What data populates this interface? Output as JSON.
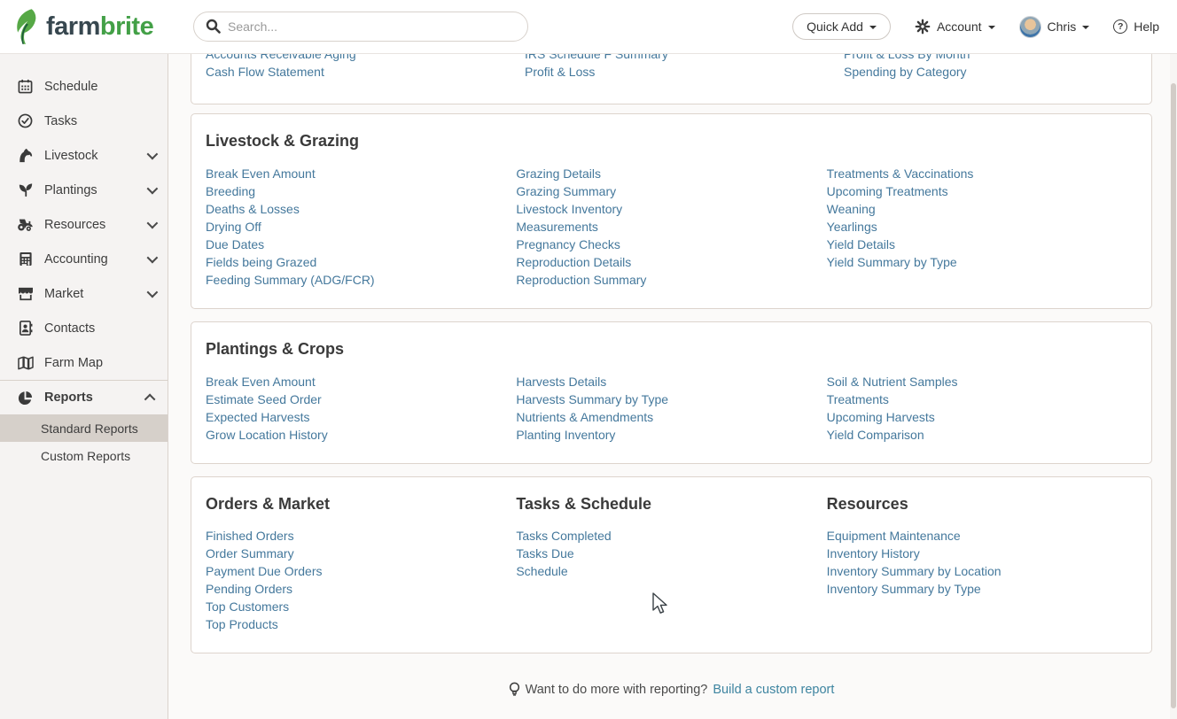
{
  "header": {
    "logo_farm": "farm",
    "logo_brite": "brite",
    "search_placeholder": "Search...",
    "quick_add_label": "Quick Add",
    "account_label": "Account",
    "user_name": "Chris",
    "help_label": "Help"
  },
  "sidebar": {
    "items": [
      {
        "label": "Schedule",
        "icon": "calendar-icon"
      },
      {
        "label": "Tasks",
        "icon": "check-circle-icon"
      },
      {
        "label": "Livestock",
        "icon": "horse-icon",
        "expandable": true
      },
      {
        "label": "Plantings",
        "icon": "seedling-icon",
        "expandable": true
      },
      {
        "label": "Resources",
        "icon": "tractor-icon",
        "expandable": true
      },
      {
        "label": "Accounting",
        "icon": "calculator-icon",
        "expandable": true
      },
      {
        "label": "Market",
        "icon": "storefront-icon",
        "expandable": true
      },
      {
        "label": "Contacts",
        "icon": "address-book-icon"
      },
      {
        "label": "Farm Map",
        "icon": "map-icon"
      },
      {
        "label": "Reports",
        "icon": "pie-chart-icon",
        "expanded": true
      }
    ],
    "sub_items": [
      {
        "label": "Standard Reports",
        "active": true
      },
      {
        "label": "Custom Reports",
        "active": false
      }
    ]
  },
  "main": {
    "cards": [
      {
        "title": "",
        "columns": [
          {
            "links": [
              "Accounts Receivable Aging",
              "Cash Flow Statement"
            ]
          },
          {
            "links": [
              "IRS Schedule F Summary",
              "Profit & Loss"
            ]
          },
          {
            "links": [
              "Profit & Loss By Month",
              "Spending by Category"
            ]
          }
        ]
      },
      {
        "title": "Livestock & Grazing",
        "columns": [
          {
            "links": [
              "Break Even Amount",
              "Breeding",
              "Deaths & Losses",
              "Drying Off",
              "Due Dates",
              "Fields being Grazed",
              "Feeding Summary (ADG/FCR)"
            ]
          },
          {
            "links": [
              "Grazing Details",
              "Grazing Summary",
              "Livestock Inventory",
              "Measurements",
              "Pregnancy Checks",
              "Reproduction Details",
              "Reproduction Summary"
            ]
          },
          {
            "links": [
              "Treatments & Vaccinations",
              "Upcoming Treatments",
              "Weaning",
              "Yearlings",
              "Yield Details",
              "Yield Summary by Type"
            ]
          }
        ]
      },
      {
        "title": "Plantings & Crops",
        "columns": [
          {
            "links": [
              "Break Even Amount",
              "Estimate Seed Order",
              "Expected Harvests",
              "Grow Location History"
            ]
          },
          {
            "links": [
              "Harvests Details",
              "Harvests Summary by Type",
              "Nutrients & Amendments",
              "Planting Inventory"
            ]
          },
          {
            "links": [
              "Soil & Nutrient Samples",
              "Treatments",
              "Upcoming Harvests",
              "Yield Comparison"
            ]
          }
        ]
      },
      {
        "title": "",
        "columns": [
          {
            "heading": "Orders & Market",
            "links": [
              "Finished Orders",
              "Order Summary",
              "Payment Due Orders",
              "Pending Orders",
              "Top Customers",
              "Top Products"
            ]
          },
          {
            "heading": "Tasks & Schedule",
            "links": [
              "Tasks Completed",
              "Tasks Due",
              "Schedule"
            ]
          },
          {
            "heading": "Resources",
            "links": [
              "Equipment Maintenance",
              "Inventory History",
              "Inventory Summary by Location",
              "Inventory Summary by Type"
            ]
          }
        ]
      }
    ]
  },
  "footer": {
    "prompt": "Want to do more with reporting?",
    "link_label": "Build a custom report"
  },
  "colors": {
    "brand_green": "#43a047",
    "logo_dark": "#37474f",
    "link": "#44789c",
    "sidebar_bg": "#f5f3f2",
    "sidebar_active_bg": "#d6d0ca",
    "border": "#ddd4cd",
    "text": "#3c3c3c",
    "muted": "#9a9a9a",
    "header_bg": "#ffffff",
    "main_bg": "#fbfaf9"
  }
}
